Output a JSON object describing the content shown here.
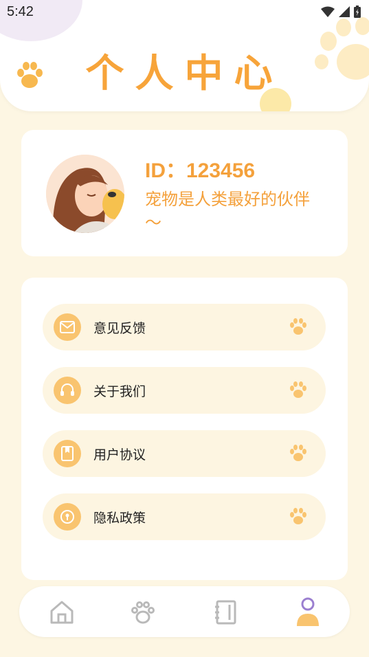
{
  "status_bar": {
    "time": "5:42"
  },
  "header": {
    "title": "个人中心"
  },
  "profile": {
    "id_text": "ID：123456",
    "motto": "宠物是人类最好的伙伴～"
  },
  "menu": {
    "items": [
      {
        "label": "意见反馈",
        "icon": "mail-icon"
      },
      {
        "label": "关于我们",
        "icon": "headset-icon"
      },
      {
        "label": "用户协议",
        "icon": "book-icon"
      },
      {
        "label": "隐私政策",
        "icon": "lock-icon"
      }
    ]
  },
  "bottom_nav": {
    "items": [
      "home-icon",
      "paw-icon",
      "notebook-icon",
      "profile-icon"
    ],
    "active_index": 3
  },
  "colors": {
    "accent": "#f4a13c",
    "background": "#fdf6e3",
    "menu_item_bg": "#fdf5e1",
    "icon_bg": "#f9c46f",
    "active_nav": "#9b7fd0"
  }
}
